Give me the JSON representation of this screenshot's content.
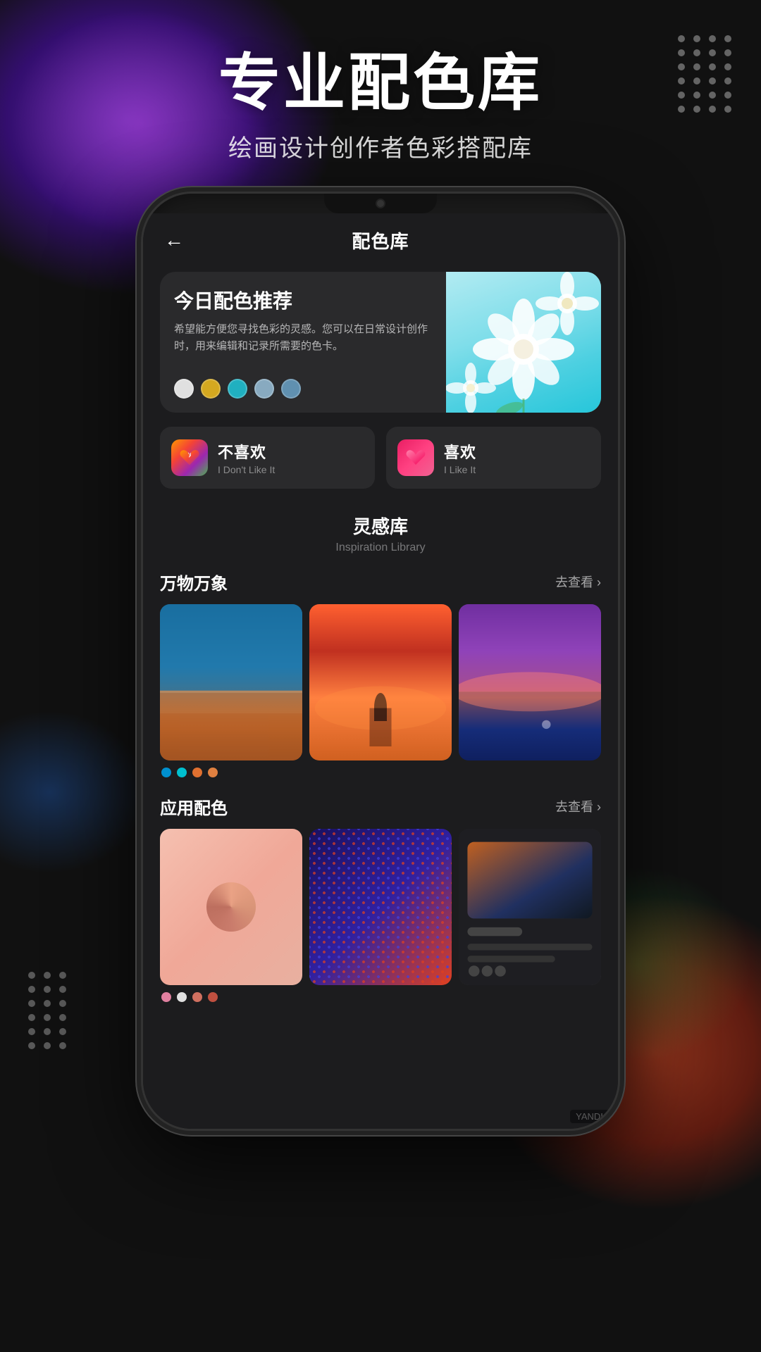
{
  "hero": {
    "title": "专业配色库",
    "subtitle": "绘画设计创作者色彩搭配库"
  },
  "app": {
    "topbar_title": "配色库",
    "back_label": "←"
  },
  "daily_card": {
    "title": "今日配色推荐",
    "description": "希望能方便您寻找色彩的灵感。您可以在日常设计创作时，用来编辑和记录所需要的色卡。",
    "colors": [
      {
        "hex": "#e0e0e0",
        "label": "white-gray"
      },
      {
        "hex": "#d4a820",
        "label": "gold"
      },
      {
        "hex": "#20b0c0",
        "label": "cyan"
      },
      {
        "hex": "#88aac0",
        "label": "blue-gray"
      },
      {
        "hex": "#6090b0",
        "label": "steel-blue"
      }
    ]
  },
  "actions": {
    "dislike": {
      "main_text": "不喜欢",
      "sub_text": "I Don't Like It",
      "icon": "💔"
    },
    "like": {
      "main_text": "喜欢",
      "sub_text": "I Like It",
      "icon": "💗"
    }
  },
  "inspiration": {
    "section_title_cn": "灵感库",
    "section_title_en": "Inspiration Library",
    "categories": [
      {
        "title": "万物万象",
        "link_label": "去查看 ›",
        "dots": [
          "#0090d0",
          "#00c0d0",
          "#e07030",
          "#e08040"
        ]
      },
      {
        "title": "应用配色",
        "link_label": "去查看 ›",
        "dots": [
          "#e080a0",
          "#e0e0e0",
          "#d07060",
          "#c05040"
        ]
      }
    ]
  },
  "dot_pattern": {
    "rows": 6,
    "cols": 4
  },
  "watermark": "YANDK"
}
